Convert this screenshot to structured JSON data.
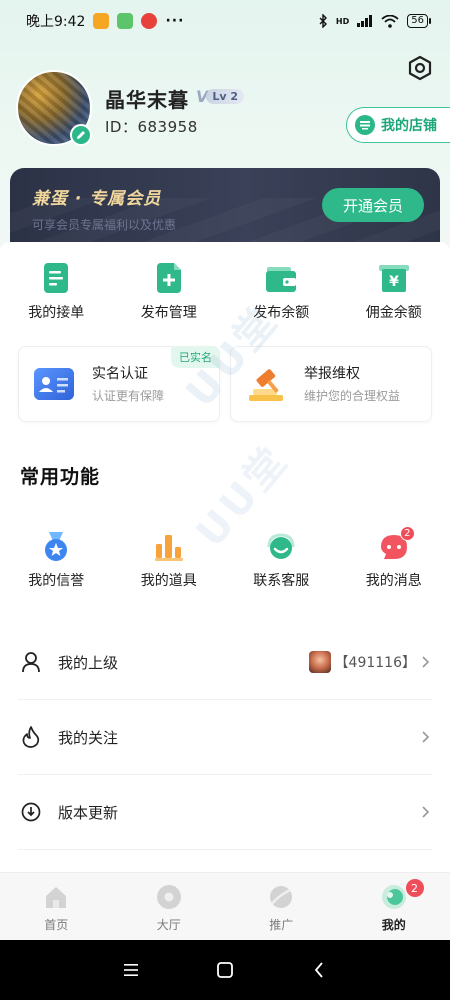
{
  "status_bar": {
    "time": "晚上9:42",
    "more": "···",
    "network": "HD",
    "battery": "56"
  },
  "profile": {
    "name": "晶华末暮",
    "vip_letter": "V",
    "level": "Lv 2",
    "id_text": "ID：683958",
    "store_button": "我的店铺"
  },
  "vip_banner": {
    "title": "兼蛋 · 专属会员",
    "subtitle": "可享会员专属福利以及优惠",
    "button": "开通会员"
  },
  "quick_actions": [
    {
      "label": "我的接单",
      "icon": "document-icon"
    },
    {
      "label": "发布管理",
      "icon": "add-document-icon"
    },
    {
      "label": "发布余额",
      "icon": "wallet-icon"
    },
    {
      "label": "佣金余额",
      "icon": "yuan-card-icon"
    }
  ],
  "cards": {
    "realname": {
      "title": "实名认证",
      "subtitle": "认证更有保障",
      "tag": "已实名"
    },
    "report": {
      "title": "举报维权",
      "subtitle": "维护您的合理权益"
    }
  },
  "common_functions": {
    "title": "常用功能",
    "items": [
      {
        "label": "我的信誉",
        "icon": "medal-icon"
      },
      {
        "label": "我的道具",
        "icon": "bar-chart-icon"
      },
      {
        "label": "联系客服",
        "icon": "service-icon"
      },
      {
        "label": "我的消息",
        "icon": "message-icon",
        "badge": "2"
      }
    ]
  },
  "list": {
    "superior": {
      "label": "我的上级",
      "value": "【491116】"
    },
    "follow": {
      "label": "我的关注"
    },
    "update": {
      "label": "版本更新"
    }
  },
  "watermark": "UU堂",
  "tabs": [
    {
      "label": "首页"
    },
    {
      "label": "大厅"
    },
    {
      "label": "推广"
    },
    {
      "label": "我的",
      "badge": "2"
    }
  ],
  "colors": {
    "accent": "#2fb98b",
    "gold": "#f1d79b",
    "badge": "#f04d5a"
  }
}
